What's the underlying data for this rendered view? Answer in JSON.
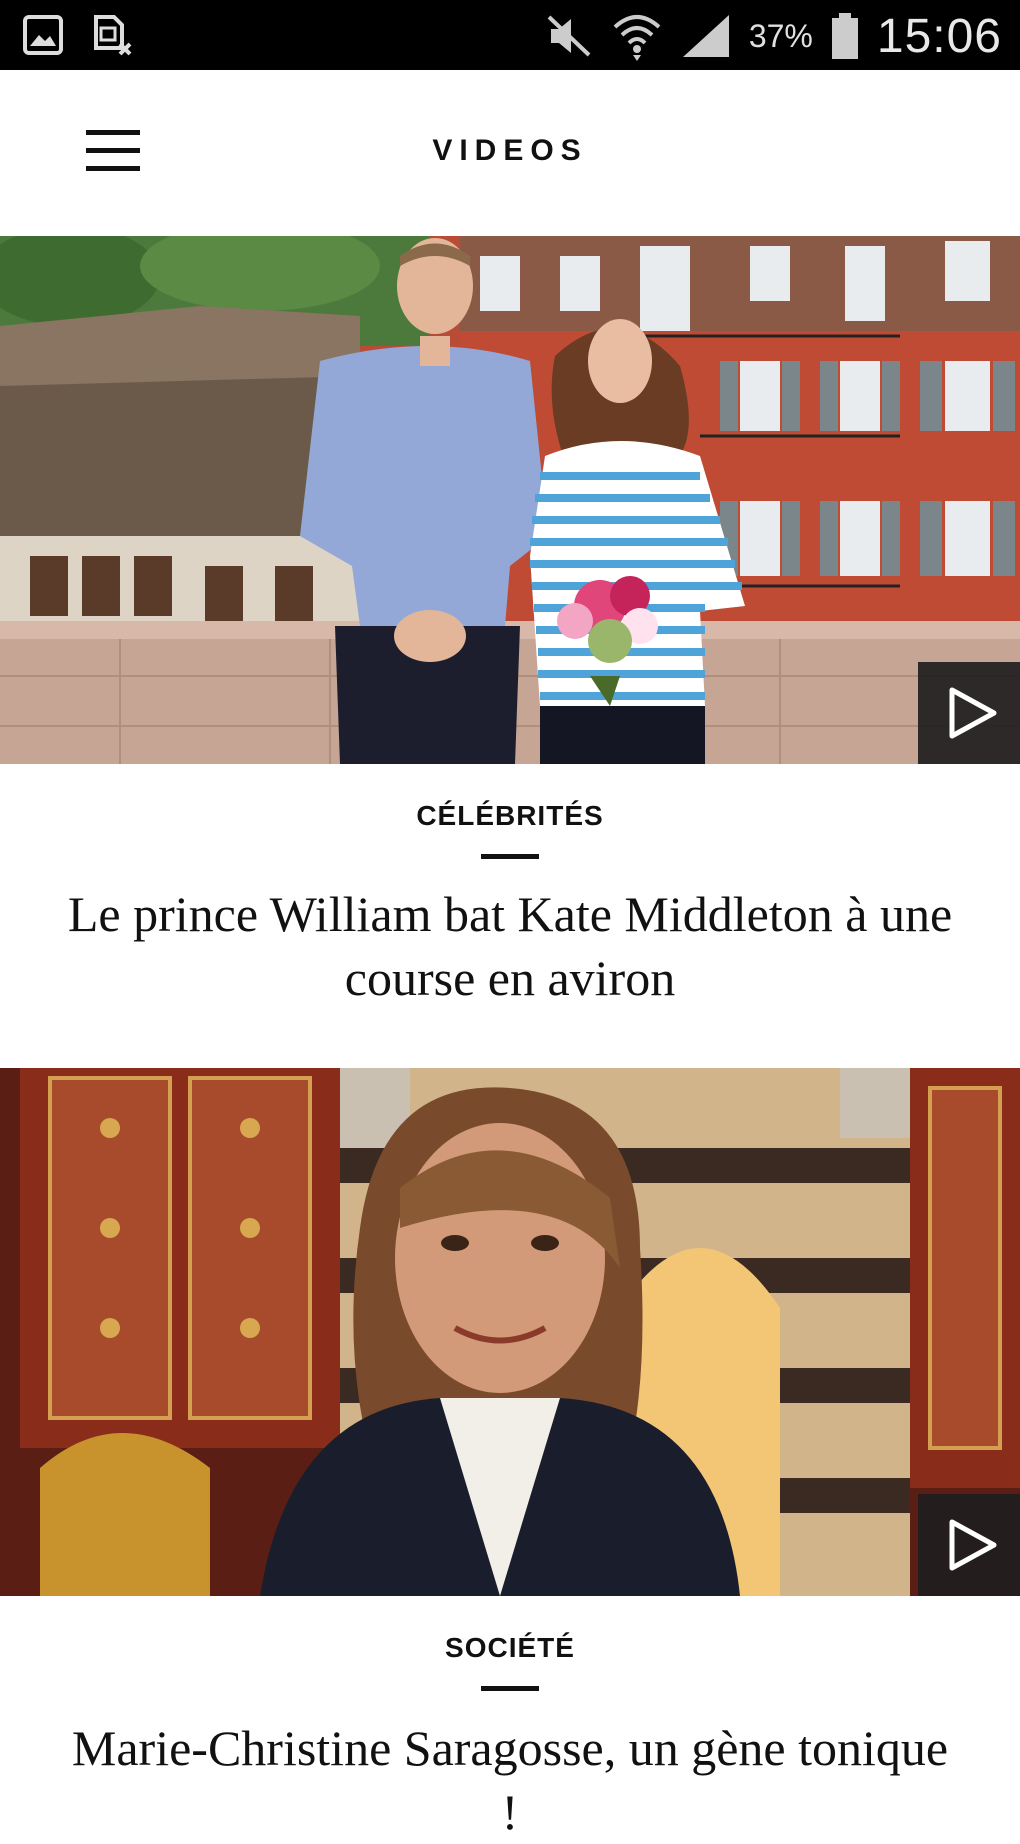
{
  "status_bar": {
    "battery": "37%",
    "time": "15:06",
    "icons": [
      "gallery-icon",
      "sim-card-error-icon",
      "mute-icon",
      "wifi-icon",
      "signal-icon",
      "battery-icon"
    ]
  },
  "header": {
    "title": "VIDEOS",
    "menu_icon": "hamburger-menu-icon"
  },
  "articles": [
    {
      "category": "CÉLÉBRITÉS",
      "title": "Le prince William bat Kate Middleton à une course en aviron",
      "play_icon": "play-icon"
    },
    {
      "category": "SOCIÉTÉ",
      "title": "Marie-Christine Saragosse, un gène tonique !",
      "play_icon": "play-icon"
    }
  ],
  "colors": {
    "status_bar_bg": "#000000",
    "text": "#111111",
    "play_button_bg": "#1e1e1e"
  }
}
